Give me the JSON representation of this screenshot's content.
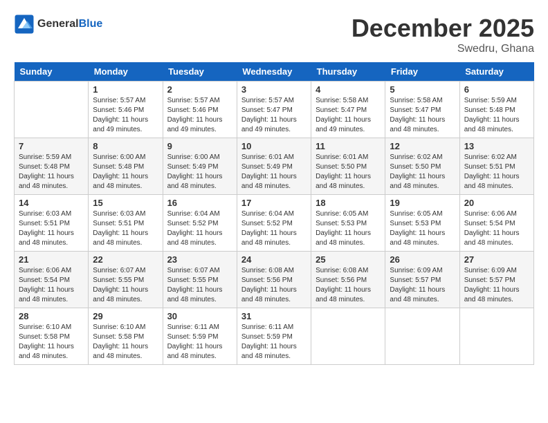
{
  "header": {
    "logo_general": "General",
    "logo_blue": "Blue",
    "month_year": "December 2025",
    "location": "Swedru, Ghana"
  },
  "days_of_week": [
    "Sunday",
    "Monday",
    "Tuesday",
    "Wednesday",
    "Thursday",
    "Friday",
    "Saturday"
  ],
  "weeks": [
    [
      {
        "date": "",
        "sunrise": "",
        "sunset": "",
        "daylight": ""
      },
      {
        "date": "1",
        "sunrise": "Sunrise: 5:57 AM",
        "sunset": "Sunset: 5:46 PM",
        "daylight": "Daylight: 11 hours and 49 minutes."
      },
      {
        "date": "2",
        "sunrise": "Sunrise: 5:57 AM",
        "sunset": "Sunset: 5:46 PM",
        "daylight": "Daylight: 11 hours and 49 minutes."
      },
      {
        "date": "3",
        "sunrise": "Sunrise: 5:57 AM",
        "sunset": "Sunset: 5:47 PM",
        "daylight": "Daylight: 11 hours and 49 minutes."
      },
      {
        "date": "4",
        "sunrise": "Sunrise: 5:58 AM",
        "sunset": "Sunset: 5:47 PM",
        "daylight": "Daylight: 11 hours and 49 minutes."
      },
      {
        "date": "5",
        "sunrise": "Sunrise: 5:58 AM",
        "sunset": "Sunset: 5:47 PM",
        "daylight": "Daylight: 11 hours and 48 minutes."
      },
      {
        "date": "6",
        "sunrise": "Sunrise: 5:59 AM",
        "sunset": "Sunset: 5:48 PM",
        "daylight": "Daylight: 11 hours and 48 minutes."
      }
    ],
    [
      {
        "date": "7",
        "sunrise": "Sunrise: 5:59 AM",
        "sunset": "Sunset: 5:48 PM",
        "daylight": "Daylight: 11 hours and 48 minutes."
      },
      {
        "date": "8",
        "sunrise": "Sunrise: 6:00 AM",
        "sunset": "Sunset: 5:48 PM",
        "daylight": "Daylight: 11 hours and 48 minutes."
      },
      {
        "date": "9",
        "sunrise": "Sunrise: 6:00 AM",
        "sunset": "Sunset: 5:49 PM",
        "daylight": "Daylight: 11 hours and 48 minutes."
      },
      {
        "date": "10",
        "sunrise": "Sunrise: 6:01 AM",
        "sunset": "Sunset: 5:49 PM",
        "daylight": "Daylight: 11 hours and 48 minutes."
      },
      {
        "date": "11",
        "sunrise": "Sunrise: 6:01 AM",
        "sunset": "Sunset: 5:50 PM",
        "daylight": "Daylight: 11 hours and 48 minutes."
      },
      {
        "date": "12",
        "sunrise": "Sunrise: 6:02 AM",
        "sunset": "Sunset: 5:50 PM",
        "daylight": "Daylight: 11 hours and 48 minutes."
      },
      {
        "date": "13",
        "sunrise": "Sunrise: 6:02 AM",
        "sunset": "Sunset: 5:51 PM",
        "daylight": "Daylight: 11 hours and 48 minutes."
      }
    ],
    [
      {
        "date": "14",
        "sunrise": "Sunrise: 6:03 AM",
        "sunset": "Sunset: 5:51 PM",
        "daylight": "Daylight: 11 hours and 48 minutes."
      },
      {
        "date": "15",
        "sunrise": "Sunrise: 6:03 AM",
        "sunset": "Sunset: 5:51 PM",
        "daylight": "Daylight: 11 hours and 48 minutes."
      },
      {
        "date": "16",
        "sunrise": "Sunrise: 6:04 AM",
        "sunset": "Sunset: 5:52 PM",
        "daylight": "Daylight: 11 hours and 48 minutes."
      },
      {
        "date": "17",
        "sunrise": "Sunrise: 6:04 AM",
        "sunset": "Sunset: 5:52 PM",
        "daylight": "Daylight: 11 hours and 48 minutes."
      },
      {
        "date": "18",
        "sunrise": "Sunrise: 6:05 AM",
        "sunset": "Sunset: 5:53 PM",
        "daylight": "Daylight: 11 hours and 48 minutes."
      },
      {
        "date": "19",
        "sunrise": "Sunrise: 6:05 AM",
        "sunset": "Sunset: 5:53 PM",
        "daylight": "Daylight: 11 hours and 48 minutes."
      },
      {
        "date": "20",
        "sunrise": "Sunrise: 6:06 AM",
        "sunset": "Sunset: 5:54 PM",
        "daylight": "Daylight: 11 hours and 48 minutes."
      }
    ],
    [
      {
        "date": "21",
        "sunrise": "Sunrise: 6:06 AM",
        "sunset": "Sunset: 5:54 PM",
        "daylight": "Daylight: 11 hours and 48 minutes."
      },
      {
        "date": "22",
        "sunrise": "Sunrise: 6:07 AM",
        "sunset": "Sunset: 5:55 PM",
        "daylight": "Daylight: 11 hours and 48 minutes."
      },
      {
        "date": "23",
        "sunrise": "Sunrise: 6:07 AM",
        "sunset": "Sunset: 5:55 PM",
        "daylight": "Daylight: 11 hours and 48 minutes."
      },
      {
        "date": "24",
        "sunrise": "Sunrise: 6:08 AM",
        "sunset": "Sunset: 5:56 PM",
        "daylight": "Daylight: 11 hours and 48 minutes."
      },
      {
        "date": "25",
        "sunrise": "Sunrise: 6:08 AM",
        "sunset": "Sunset: 5:56 PM",
        "daylight": "Daylight: 11 hours and 48 minutes."
      },
      {
        "date": "26",
        "sunrise": "Sunrise: 6:09 AM",
        "sunset": "Sunset: 5:57 PM",
        "daylight": "Daylight: 11 hours and 48 minutes."
      },
      {
        "date": "27",
        "sunrise": "Sunrise: 6:09 AM",
        "sunset": "Sunset: 5:57 PM",
        "daylight": "Daylight: 11 hours and 48 minutes."
      }
    ],
    [
      {
        "date": "28",
        "sunrise": "Sunrise: 6:10 AM",
        "sunset": "Sunset: 5:58 PM",
        "daylight": "Daylight: 11 hours and 48 minutes."
      },
      {
        "date": "29",
        "sunrise": "Sunrise: 6:10 AM",
        "sunset": "Sunset: 5:58 PM",
        "daylight": "Daylight: 11 hours and 48 minutes."
      },
      {
        "date": "30",
        "sunrise": "Sunrise: 6:11 AM",
        "sunset": "Sunset: 5:59 PM",
        "daylight": "Daylight: 11 hours and 48 minutes."
      },
      {
        "date": "31",
        "sunrise": "Sunrise: 6:11 AM",
        "sunset": "Sunset: 5:59 PM",
        "daylight": "Daylight: 11 hours and 48 minutes."
      },
      {
        "date": "",
        "sunrise": "",
        "sunset": "",
        "daylight": ""
      },
      {
        "date": "",
        "sunrise": "",
        "sunset": "",
        "daylight": ""
      },
      {
        "date": "",
        "sunrise": "",
        "sunset": "",
        "daylight": ""
      }
    ]
  ]
}
